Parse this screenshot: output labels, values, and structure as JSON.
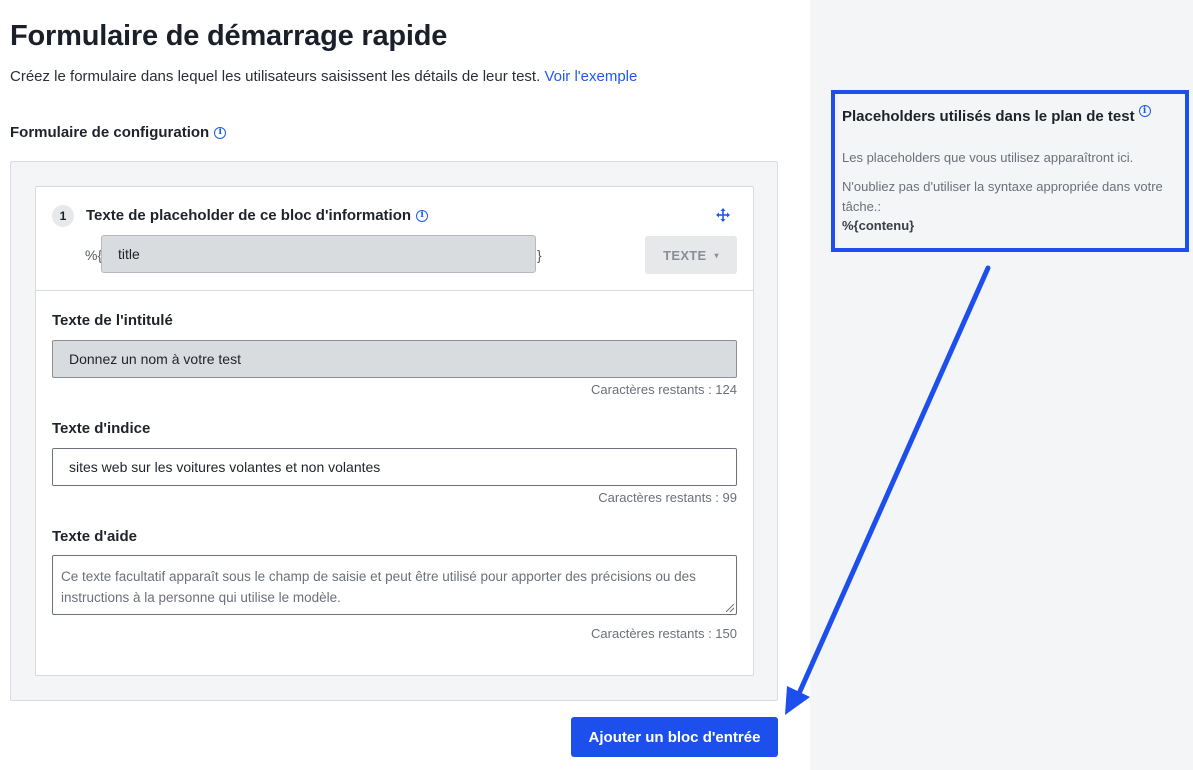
{
  "header": {
    "title": "Formulaire de démarrage rapide",
    "subtitle": "Créez le formulaire dans lequel les utilisateurs saisissent les détails de leur test.",
    "example_link": "Voir l'exemple"
  },
  "config": {
    "title": "Formulaire de configuration",
    "info_icon": "info-icon"
  },
  "block": {
    "number": "1",
    "title": "Texte de placeholder de ce bloc d'information",
    "move_icon": "move-icon",
    "placeholder_prefix": "%{",
    "placeholder_value": "title",
    "placeholder_suffix": "}",
    "type_label": "TEXTE",
    "type_caret": "▾",
    "label_field": {
      "label": "Texte de l'intitulé",
      "value": "Donnez un nom à votre test",
      "counter": "Caractères restants : 124"
    },
    "hint_field": {
      "label": "Texte d'indice",
      "value": "sites web sur les voitures volantes et non volantes",
      "counter": "Caractères restants : 99"
    },
    "help_field": {
      "label": "Texte d'aide",
      "placeholder": "Ce texte facultatif apparaît sous le champ de saisie et peut être utilisé pour apporter des précisions ou des instructions à la personne qui utilise le modèle.",
      "counter": "Caractères restants : 150"
    }
  },
  "actions": {
    "add_block": "Ajouter un bloc d'entrée"
  },
  "sidebar": {
    "title": "Placeholders utilisés dans le plan de test",
    "line1": "Les placeholders que vous utilisez apparaîtront ici.",
    "line2": "N'oubliez pas d'utiliser la syntaxe appropriée dans votre tâche.:",
    "syntax": "%{contenu}"
  },
  "colors": {
    "accent": "#1d4fed",
    "link": "#1d5be8",
    "panel_bg": "#f3f5f6",
    "disabled_bg": "#d9dcdf"
  }
}
